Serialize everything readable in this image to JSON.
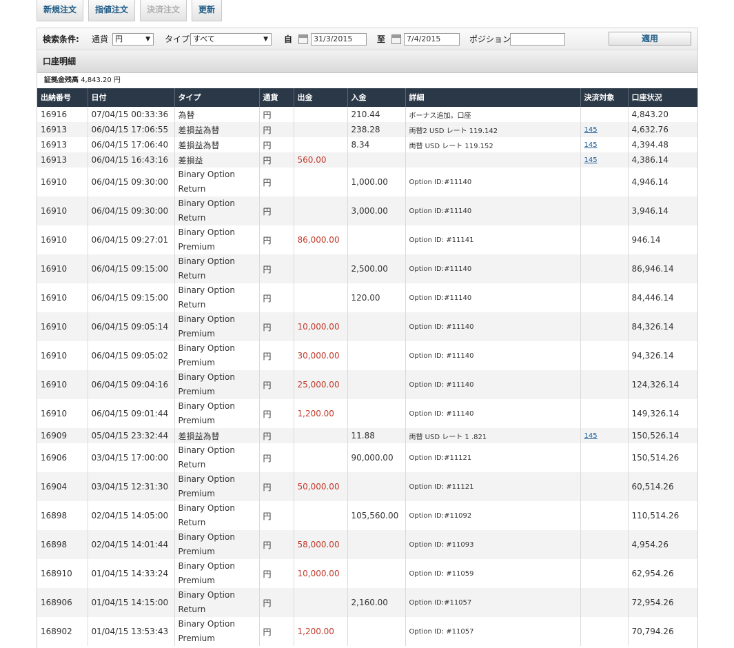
{
  "toolbar": {
    "new_order": "新規注文",
    "limit_order": "指値注文",
    "settle_order": "決済注文",
    "refresh": "更新"
  },
  "filter": {
    "label": "検索条件:",
    "currency_label": "通貨",
    "currency_value": "円",
    "type_label": "タイプ",
    "type_value": "すべて",
    "from_label": "自",
    "from_date": "31/3/2015",
    "to_label": "至",
    "to_date": "7/4/2015",
    "position_label": "ポジション",
    "position_value": "",
    "apply": "適用"
  },
  "section_title": "口座明細",
  "balance": {
    "label": "証拠金残高",
    "value": "4,843.20 円"
  },
  "table": {
    "headers": [
      "出納番号",
      "日付",
      "タイプ",
      "通貨",
      "出金",
      "入金",
      "詳細",
      "決済対象",
      "口座状況"
    ],
    "rows": [
      {
        "id": "16916",
        "date": "07/04/15 00:33:36",
        "type": "為替",
        "cur": "円",
        "out": "",
        "in": "210.44",
        "detail": "ボーナス追加。口座",
        "target": "",
        "balance": "4,843.20"
      },
      {
        "id": "16913",
        "date": "06/04/15 17:06:55",
        "type": "差損益為替",
        "cur": "円",
        "out": "",
        "in": "238.28",
        "detail": "両替2 USD レート 119.142",
        "target": "145",
        "balance": "4,632.76"
      },
      {
        "id": "16913",
        "date": "06/04/15 17:06:40",
        "type": "差損益為替",
        "cur": "円",
        "out": "",
        "in": "8.34",
        "detail": "両替 USD レート 119.152",
        "target": "145",
        "balance": "4,394.48"
      },
      {
        "id": "16913",
        "date": "06/04/15 16:43:16",
        "type": "差損益",
        "cur": "円",
        "out": "560.00",
        "in": "",
        "detail": "",
        "target": "145",
        "balance": "4,386.14"
      },
      {
        "id": "16910",
        "date": "06/04/15 09:30:00",
        "type": "Binary Option Return",
        "cur": "円",
        "out": "",
        "in": "1,000.00",
        "detail": "Option ID:#11140",
        "target": "",
        "balance": "4,946.14"
      },
      {
        "id": "16910",
        "date": "06/04/15 09:30:00",
        "type": "Binary Option Return",
        "cur": "円",
        "out": "",
        "in": "3,000.00",
        "detail": "Option ID:#11140",
        "target": "",
        "balance": "3,946.14"
      },
      {
        "id": "16910",
        "date": "06/04/15 09:27:01",
        "type": "Binary Option Premium",
        "cur": "円",
        "out": "86,000.00",
        "in": "",
        "detail": "Option ID: #11141",
        "target": "",
        "balance": "946.14"
      },
      {
        "id": "16910",
        "date": "06/04/15 09:15:00",
        "type": "Binary Option Return",
        "cur": "円",
        "out": "",
        "in": "2,500.00",
        "detail": "Option ID:#11140",
        "target": "",
        "balance": "86,946.14"
      },
      {
        "id": "16910",
        "date": "06/04/15 09:15:00",
        "type": "Binary Option Return",
        "cur": "円",
        "out": "",
        "in": "120.00",
        "detail": "Option ID:#11140",
        "target": "",
        "balance": "84,446.14"
      },
      {
        "id": "16910",
        "date": "06/04/15 09:05:14",
        "type": "Binary Option Premium",
        "cur": "円",
        "out": "10,000.00",
        "in": "",
        "detail": "Option ID: #11140",
        "target": "",
        "balance": "84,326.14"
      },
      {
        "id": "16910",
        "date": "06/04/15 09:05:02",
        "type": "Binary Option Premium",
        "cur": "円",
        "out": "30,000.00",
        "in": "",
        "detail": "Option ID: #11140",
        "target": "",
        "balance": "94,326.14"
      },
      {
        "id": "16910",
        "date": "06/04/15 09:04:16",
        "type": "Binary Option Premium",
        "cur": "円",
        "out": "25,000.00",
        "in": "",
        "detail": "Option ID: #11140",
        "target": "",
        "balance": "124,326.14"
      },
      {
        "id": "16910",
        "date": "06/04/15 09:01:44",
        "type": "Binary Option Premium",
        "cur": "円",
        "out": "1,200.00",
        "in": "",
        "detail": "Option ID: #11140",
        "target": "",
        "balance": "149,326.14"
      },
      {
        "id": "16909",
        "date": "05/04/15 23:32:44",
        "type": "差損益為替",
        "cur": "円",
        "out": "",
        "in": "11.88",
        "detail": "両替 USD レート 1 .821",
        "target": "145",
        "balance": "150,526.14"
      },
      {
        "id": "16906",
        "date": "03/04/15 17:00:00",
        "type": "Binary Option Return",
        "cur": "円",
        "out": "",
        "in": "90,000.00",
        "detail": "Option ID:#11121",
        "target": "",
        "balance": "150,514.26"
      },
      {
        "id": "16904",
        "date": "03/04/15 12:31:30",
        "type": "Binary Option Premium",
        "cur": "円",
        "out": "50,000.00",
        "in": "",
        "detail": "Option ID: #11121",
        "target": "",
        "balance": "60,514.26"
      },
      {
        "id": "16898",
        "date": "02/04/15 14:05:00",
        "type": "Binary Option Return",
        "cur": "円",
        "out": "",
        "in": "105,560.00",
        "detail": "Option ID:#11092",
        "target": "",
        "balance": "110,514.26"
      },
      {
        "id": "16898",
        "date": "02/04/15 14:01:44",
        "type": "Binary Option Premium",
        "cur": "円",
        "out": "58,000.00",
        "in": "",
        "detail": "Option ID: #11093",
        "target": "",
        "balance": "4,954.26"
      },
      {
        "id": "168910",
        "date": "01/04/15 14:33:24",
        "type": "Binary Option Premium",
        "cur": "円",
        "out": "10,000.00",
        "in": "",
        "detail": "Option ID: #11059",
        "target": "",
        "balance": "62,954.26"
      },
      {
        "id": "168906",
        "date": "01/04/15 14:15:00",
        "type": "Binary Option Return",
        "cur": "円",
        "out": "",
        "in": "2,160.00",
        "detail": "Option ID:#11057",
        "target": "",
        "balance": "72,954.26"
      },
      {
        "id": "168902",
        "date": "01/04/15 13:53:43",
        "type": "Binary Option Premium",
        "cur": "円",
        "out": "1,200.00",
        "in": "",
        "detail": "Option ID: #11057",
        "target": "",
        "balance": "70,794.26"
      }
    ]
  }
}
